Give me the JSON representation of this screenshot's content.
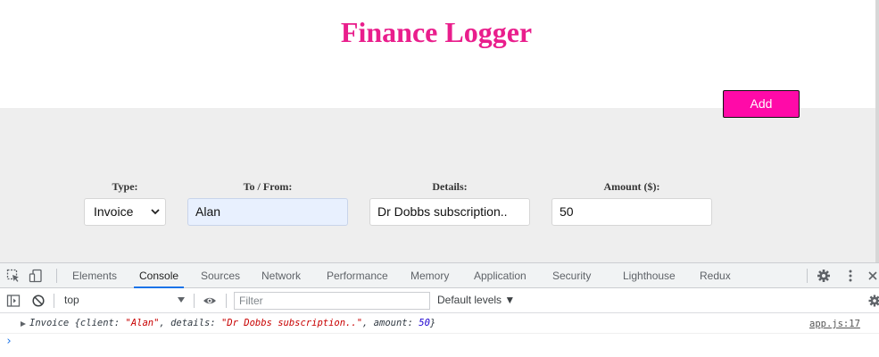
{
  "app": {
    "title": "Finance Logger",
    "colors": {
      "title": "#e91e8c",
      "add_button": "#ff0aa8"
    },
    "form": {
      "type_label": "Type:",
      "type_value": "Invoice",
      "tofrom_label": "To / From:",
      "tofrom_value": "Alan",
      "details_label": "Details:",
      "details_value": "Dr Dobbs subscription..",
      "amount_label": "Amount ($):",
      "amount_value": "50",
      "add_label": "Add"
    }
  },
  "devtools": {
    "tabs": [
      "Elements",
      "Console",
      "Sources",
      "Network",
      "Performance",
      "Memory",
      "Application",
      "Security",
      "Lighthouse",
      "Redux"
    ],
    "active_tab": "Console",
    "icons": [
      "inspect-element-icon",
      "device-toggle-icon",
      "settings-gear-icon",
      "kebab-menu-icon",
      "close-icon",
      "sidebar-toggle-icon",
      "clear-console-icon",
      "eye-icon",
      "console-settings-icon"
    ],
    "console_toolbar": {
      "context": "top",
      "filter_placeholder": "Filter",
      "levels": "Default levels ▼"
    },
    "log": {
      "class_name": "Invoice",
      "open": "{",
      "client_key": "client: ",
      "client_value": "\"Alan\"",
      "details_key": ", details: ",
      "details_value": "\"Dr Dobbs subscription..\"",
      "amount_key": ", amount: ",
      "amount_value": "50",
      "close": "}",
      "source": "app.js:17"
    },
    "prompt": "›"
  }
}
